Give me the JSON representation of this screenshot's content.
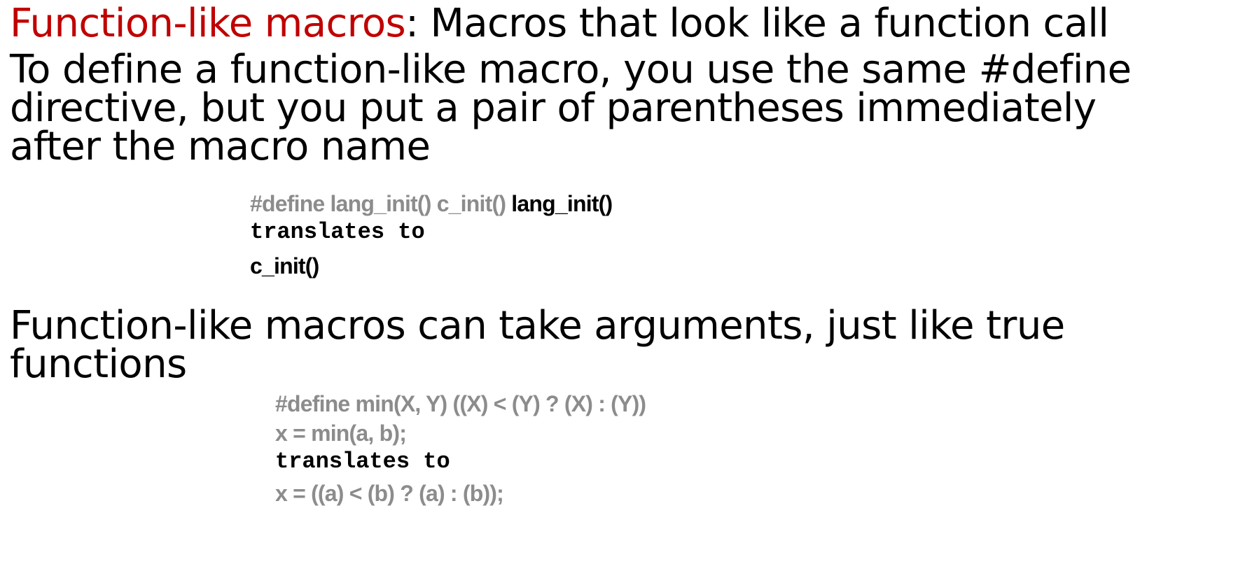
{
  "heading": {
    "term": "Function-like macros",
    "rest": ": Macros that look like a function call"
  },
  "intro": {
    "line1": "To define a function-like macro, you use the same #define",
    "line2": "directive, but you put a pair of parentheses immediately",
    "line3": "after the macro name"
  },
  "example1": {
    "define": "#define lang_init() c_init() ",
    "call": "lang_init()",
    "translates": "translates to",
    "result": "c_init()"
  },
  "arguments": {
    "line1": "Function-like macros can take arguments, just like true",
    "line2": "functions"
  },
  "example2": {
    "define": "#define min(X, Y) ((X) < (Y) ? (X) : (Y))",
    "call": "x = min(a, b);",
    "translates": "translates to",
    "result": "x = ((a) < (b) ? (a) : (b));"
  },
  "colors": {
    "accent": "#c00000",
    "code_gray": "#8c8c8c",
    "text": "#000000",
    "background": "#ffffff"
  }
}
